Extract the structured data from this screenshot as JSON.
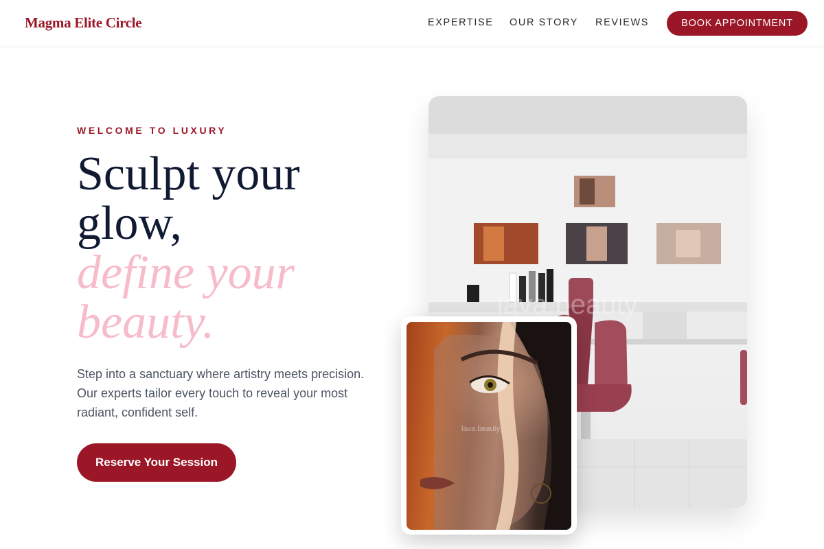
{
  "header": {
    "logo": "Magma Elite Circle",
    "nav": [
      {
        "label": "EXPERTISE"
      },
      {
        "label": "OUR STORY"
      },
      {
        "label": "REVIEWS"
      }
    ],
    "cta_label": "BOOK APPOINTMENT"
  },
  "hero": {
    "eyebrow": "WELCOME TO LUXURY",
    "headline_line1": "Sculpt your",
    "headline_line2": "glow,",
    "headline_accent_line1": "define your",
    "headline_accent_line2": "beauty.",
    "body": "Step into a sanctuary where artistry meets precision. Our experts tailor every touch to reveal your most radiant, confident self.",
    "cta_label": "Reserve Your Session"
  },
  "images": {
    "salon_watermark": "lava.beauty",
    "portrait_watermark": "lava.beauty"
  },
  "colors": {
    "brand": "#9b1727",
    "headline": "#111a33",
    "accent_pink": "#f6bcc9",
    "body_text": "#4b5563"
  }
}
